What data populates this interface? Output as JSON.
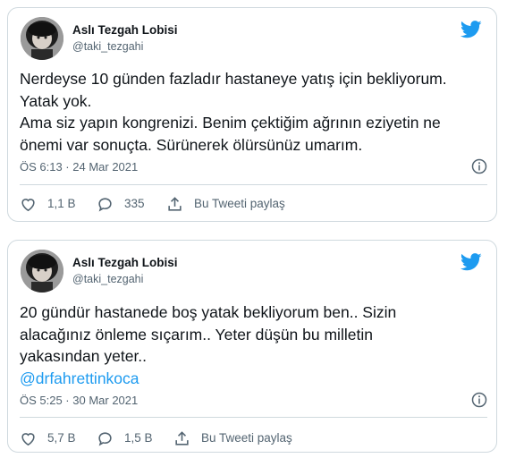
{
  "tweets": [
    {
      "display_name": "Aslı Tezgah Lobisi",
      "handle": "@taki_tezgahi",
      "lines": [
        "Nerdeyse 10 günden fazladır hastaneye yatış için bekliyorum.",
        "Yatak yok.",
        "Ama siz yapın kongrenizi. Benim çektiğim ağrının eziyetin ne",
        "önemi var sonuçta. Sürünerek ölürsünüz umarım."
      ],
      "timestamp": "ÖS 6:13 · 24 Mar 2021",
      "likes": "1,1 B",
      "replies": "335",
      "share_label": "Bu Tweeti paylaş"
    },
    {
      "display_name": "Aslı Tezgah Lobisi",
      "handle": "@taki_tezgahi",
      "lines": [
        "20 gündür hastanede boş yatak bekliyorum ben.. Sizin",
        "alacağınız önleme sıçarım.. Yeter düşün bu milletin",
        "yakasından yeter.."
      ],
      "mention": "@drfahrettinkoca",
      "timestamp": "ÖS 5:25 · 30 Mar 2021",
      "likes": "5,7 B",
      "replies": "1,5 B",
      "share_label": "Bu Tweeti paylaş"
    }
  ],
  "colors": {
    "accent": "#1d9bf0",
    "text": "#0f1419",
    "muted": "#536471",
    "border": "#cfd9de"
  },
  "icons": [
    "twitter-bird-icon",
    "info-icon",
    "heart-icon",
    "reply-icon",
    "share-icon"
  ]
}
